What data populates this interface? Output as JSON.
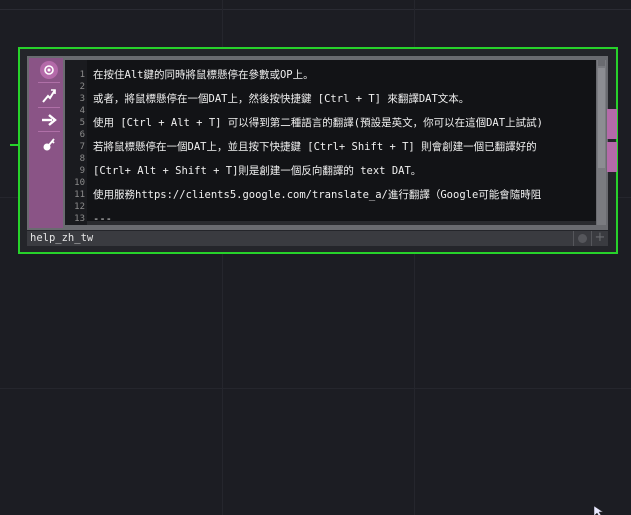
{
  "node": {
    "name": "help_zh_tw",
    "side_buttons": [
      {
        "icon": "viewer-icon"
      },
      {
        "icon": "bypass-icon"
      },
      {
        "icon": "export-arrow-icon"
      },
      {
        "icon": "lock-icon"
      }
    ]
  },
  "editor": {
    "line_numbers": [
      "1",
      "2",
      "3",
      "4",
      "5",
      "6",
      "7",
      "8",
      "9",
      "10",
      "11",
      "12",
      "13"
    ],
    "lines": [
      "在按住Alt鍵的同時將鼠標懸停在參數或OP上。",
      "或者，將鼠標懸停在一個DAT上，然後按快捷鍵 [Ctrl + T] 來翻譯DAT文本。",
      "使用 [Ctrl + Alt + T] 可以得到第二種語言的翻譯(預設是英文，你可以在這個DAT上試試)",
      "若將鼠標懸停在一個DAT上，並且按下快捷鍵 [Ctrl+ Shift + T] 則會創建一個已翻譯好的",
      "[Ctrl+ Alt + Shift + T]則是創建一個反向翻譯的 text DAT。",
      "使用服務https://clients5.google.com/translate_a/進行翻譯（Google可能會隨時阻",
      "---"
    ]
  },
  "colors": {
    "selection_border": "#27d22b",
    "sidebar": "#8a5486",
    "background": "#1c1d23"
  }
}
